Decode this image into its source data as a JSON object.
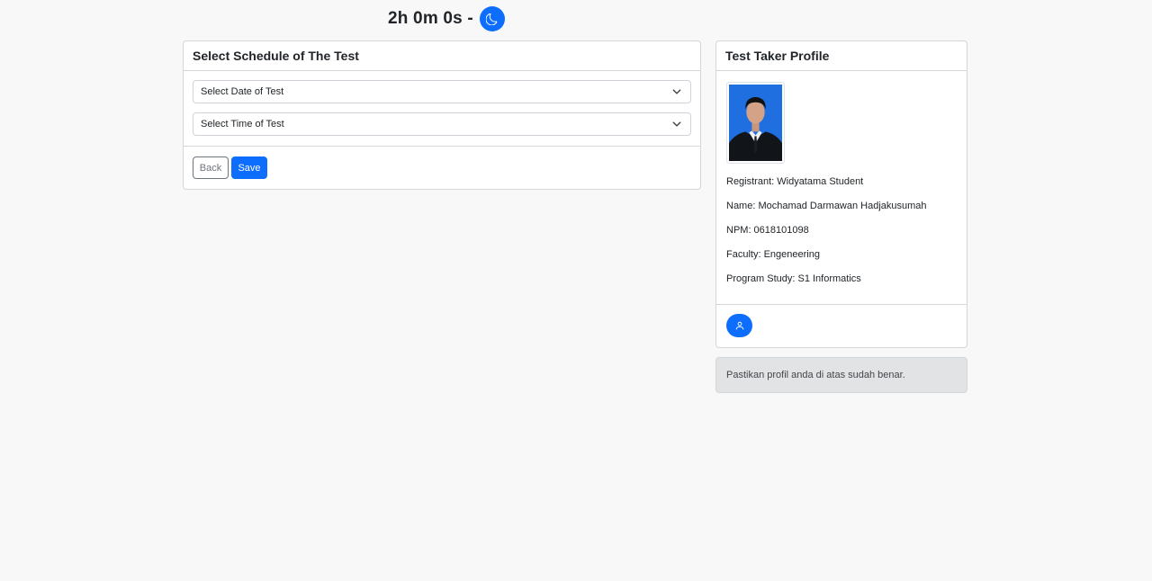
{
  "timer": {
    "text": "2h 0m 0s -"
  },
  "theme_toggle": {
    "icon": "moon-icon"
  },
  "schedule": {
    "title": "Select Schedule of The Test",
    "date_select": {
      "value": "Select Date of Test",
      "icon": "chevron-down-icon"
    },
    "time_select": {
      "value": "Select Time of Test",
      "icon": "chevron-down-icon"
    },
    "back_label": "Back",
    "save_label": "Save"
  },
  "profile": {
    "title": "Test Taker Profile",
    "registrant": "Registrant: Widyatama Student",
    "name": "Name: Mochamad Darmawan Hadjakusumah",
    "npm": "NPM: 0618101098",
    "faculty": "Faculty: Engeneering",
    "program": "Program Study: S1 Informatics",
    "edit_icon": "user-icon"
  },
  "alert": {
    "text": "Pastikan profil anda di atas sudah benar."
  },
  "colors": {
    "primary": "#0d6efd",
    "background": "#f8f8f8",
    "alert_bg": "#e2e3e5"
  }
}
